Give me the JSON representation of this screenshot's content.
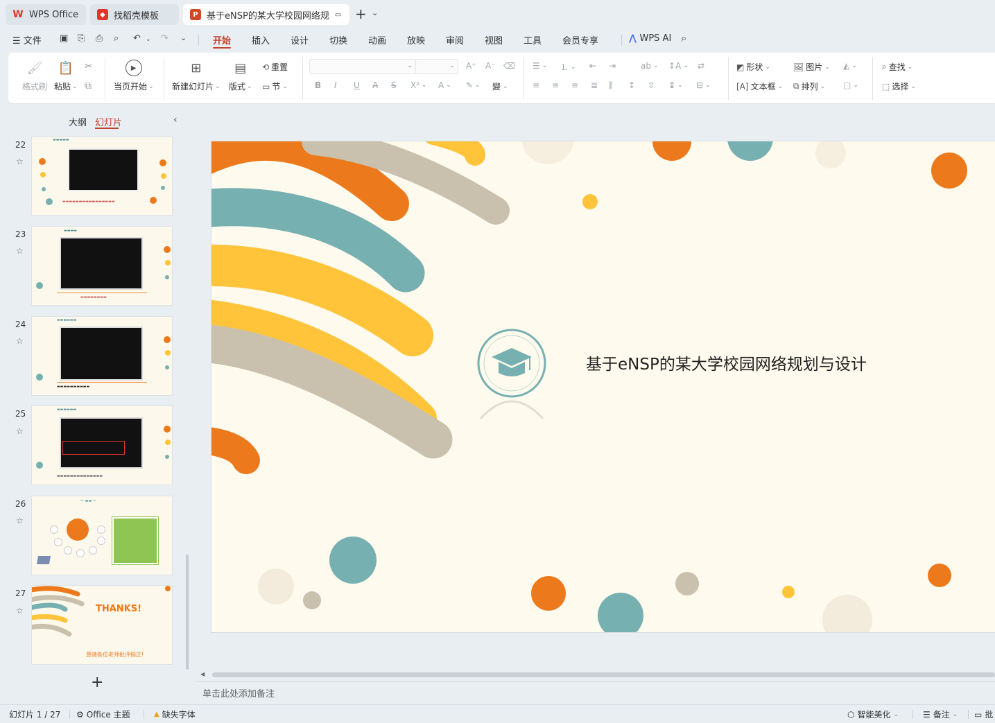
{
  "tabs": [
    {
      "label": "WPS Office",
      "logo": "W",
      "color": "#e0352b"
    },
    {
      "label": "找稻壳模板",
      "logo": "◆",
      "color": "#e0352b"
    },
    {
      "label": "基于eNSP的某大学校园网络规",
      "logo": "P",
      "color": "#d24726"
    }
  ],
  "menu": {
    "file": "文件",
    "items": [
      "开始",
      "插入",
      "设计",
      "切换",
      "动画",
      "放映",
      "审阅",
      "视图",
      "工具",
      "会员专享"
    ],
    "active": "开始",
    "wps_ai": "WPS AI"
  },
  "ribbon": {
    "format_painter": "格式刷",
    "paste": "粘贴",
    "start_from_current": "当页开始",
    "new_slide": "新建幻灯片",
    "layout": "版式",
    "section": "节",
    "reset": "重置",
    "shape": "形状",
    "picture": "图片",
    "find": "查找",
    "textbox": "文本框",
    "arrange": "排列",
    "select": "选择"
  },
  "left_panel": {
    "tab_outline": "大纲",
    "tab_slides": "幻灯片",
    "active_tab": "幻灯片",
    "slides": [
      {
        "num": "22"
      },
      {
        "num": "23"
      },
      {
        "num": "24"
      },
      {
        "num": "25"
      },
      {
        "num": "26"
      },
      {
        "num": "27",
        "thanks": "THANKS!",
        "thanks_sub": "恳请各位老师批评指正!"
      }
    ]
  },
  "slide": {
    "title": "基于eNSP的某大学校园网络规划与设计"
  },
  "notes_placeholder": "单击此处添加备注",
  "status": {
    "slide_counter": "幻灯片 1 / 27",
    "theme": "Office 主题",
    "missing_font": "缺失字体",
    "smart_beautify": "智能美化",
    "notes": "备注",
    "last": "批"
  },
  "colors": {
    "accent": "#c4432c",
    "orange": "#ec7a1c",
    "teal": "#77b0b1",
    "yellow": "#ffc43a",
    "beige": "#c9c1ae"
  }
}
